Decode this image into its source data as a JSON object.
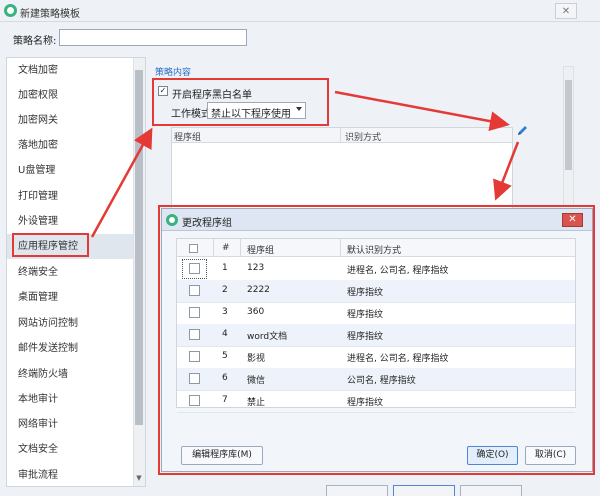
{
  "window": {
    "title": "新建策略模板",
    "close": "✕"
  },
  "name_field": {
    "label": "策略名称:",
    "value": ""
  },
  "sidebar": {
    "items": [
      {
        "label": "文档加密"
      },
      {
        "label": "加密权限"
      },
      {
        "label": "加密网关"
      },
      {
        "label": "落地加密"
      },
      {
        "label": "U盘管理"
      },
      {
        "label": "打印管理"
      },
      {
        "label": "外设管理"
      },
      {
        "label": "应用程序管控",
        "selected": true
      },
      {
        "label": "终端安全"
      },
      {
        "label": "桌面管理"
      },
      {
        "label": "网站访问控制"
      },
      {
        "label": "邮件发送控制"
      },
      {
        "label": "终端防火墙"
      },
      {
        "label": "本地审计"
      },
      {
        "label": "网络审计"
      },
      {
        "label": "文档安全"
      },
      {
        "label": "审批流程"
      }
    ]
  },
  "policy": {
    "section_title": "策略内容",
    "blacklist_checkbox": {
      "label": "开启程序黑白名单",
      "checked": true
    },
    "mode_label": "工作模式",
    "mode_value": "禁止以下程序使用",
    "table_headers": [
      "程序组",
      "识别方式"
    ]
  },
  "dialog": {
    "title": "更改程序组",
    "close": "✕",
    "headers": {
      "num": "#",
      "group": "程序组",
      "method": "默认识别方式"
    },
    "rows": [
      {
        "num": "1",
        "group": "123",
        "method": "进程名, 公司名, 程序指纹"
      },
      {
        "num": "2",
        "group": "2222",
        "method": "程序指纹"
      },
      {
        "num": "3",
        "group": "360",
        "method": "程序指纹"
      },
      {
        "num": "4",
        "group": "word文档",
        "method": "程序指纹"
      },
      {
        "num": "5",
        "group": "影视",
        "method": "进程名, 公司名, 程序指纹"
      },
      {
        "num": "6",
        "group": "微信",
        "method": "公司名, 程序指纹"
      },
      {
        "num": "7",
        "group": "禁止",
        "method": "程序指纹"
      }
    ],
    "buttons": {
      "edit_library": "编辑程序库(M)",
      "ok": "确定(O)",
      "cancel": "取消(C)"
    }
  },
  "icons": {
    "app": "shield-app-icon",
    "edit": "pencil-icon"
  },
  "colors": {
    "annotation": "#e53935",
    "link": "#2b6fc7",
    "selected": "#dfe6ee"
  }
}
